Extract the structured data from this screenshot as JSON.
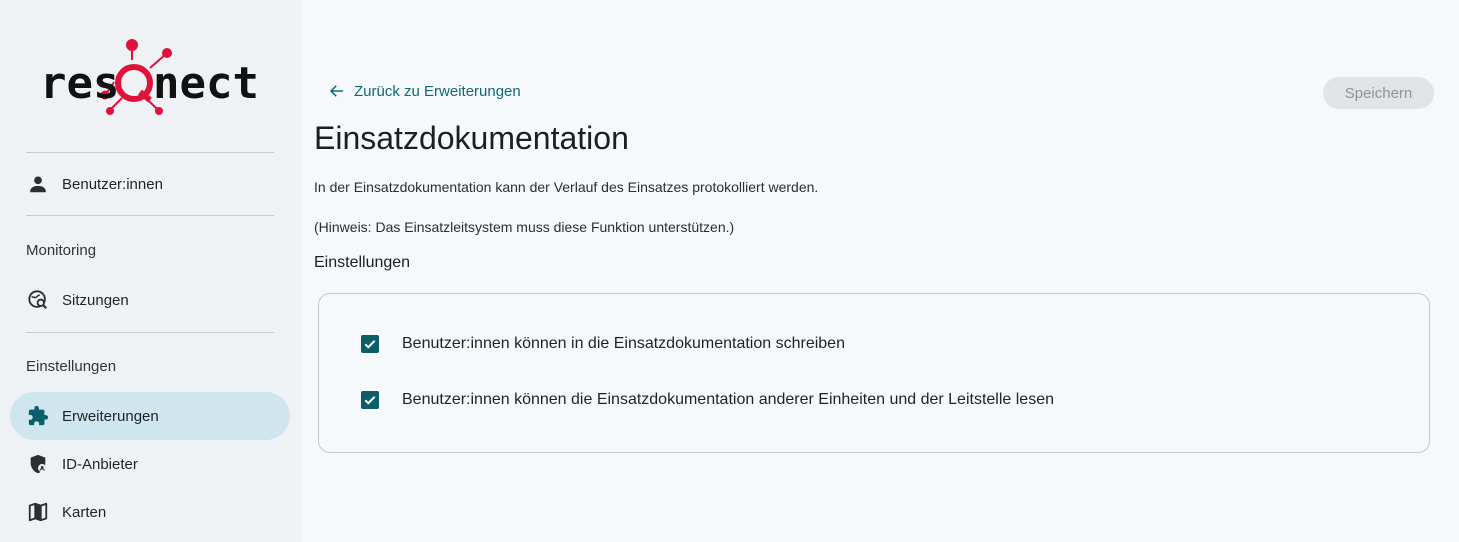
{
  "brand": {
    "name": "resQnect",
    "accent": "#e0123a"
  },
  "sidebar": {
    "items": [
      {
        "label": "Benutzer:innen",
        "icon": "person-icon"
      },
      {
        "label": "Sitzungen",
        "icon": "session-search-icon"
      },
      {
        "label": "Erweiterungen",
        "icon": "puzzle-icon",
        "active": true
      },
      {
        "label": "ID-Anbieter",
        "icon": "shield-account-icon"
      },
      {
        "label": "Karten",
        "icon": "map-icon"
      }
    ],
    "sections": {
      "monitoring": "Monitoring",
      "settings": "Einstellungen"
    }
  },
  "main": {
    "back_label": "Zurück zu Erweiterungen",
    "save_label": "Speichern",
    "title": "Einsatzdokumentation",
    "description": "In der Einsatzdokumentation kann der Verlauf des Einsatzes protokolliert werden.",
    "hint": "(Hinweis: Das Einsatzleitsystem muss diese Funktion unterstützen.)",
    "settings_heading": "Einstellungen",
    "options": [
      {
        "label": "Benutzer:innen können in die Einsatzdokumentation schreiben",
        "checked": true
      },
      {
        "label": "Benutzer:innen können die Einsatzdokumentation anderer Einheiten und der Leitstelle lesen",
        "checked": true
      }
    ]
  },
  "colors": {
    "primary": "#0d5e6b",
    "active_nav": "#cfe6ee",
    "link": "#0f6874"
  }
}
